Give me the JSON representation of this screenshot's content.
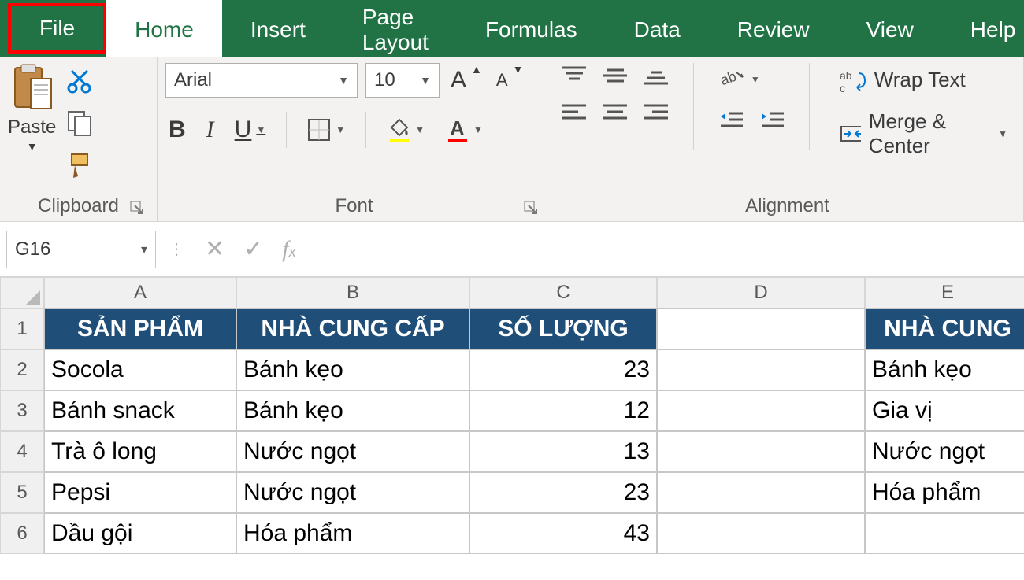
{
  "ribbon": {
    "tabs": [
      "File",
      "Home",
      "Insert",
      "Page Layout",
      "Formulas",
      "Data",
      "Review",
      "View",
      "Help"
    ],
    "activeTab": "Home",
    "clipboard": {
      "label": "Clipboard",
      "paste": "Paste"
    },
    "font": {
      "label": "Font",
      "name": "Arial",
      "size": "10",
      "bold": "B",
      "italic": "I",
      "underline": "U"
    },
    "alignment": {
      "label": "Alignment",
      "wrap": "Wrap Text",
      "merge": "Merge & Center"
    }
  },
  "formulaBar": {
    "cellRef": "G16",
    "formula": ""
  },
  "grid": {
    "columns": [
      "A",
      "B",
      "C",
      "D",
      "E"
    ],
    "rowNumbers": [
      "1",
      "2",
      "3",
      "4",
      "5",
      "6"
    ],
    "header": [
      "SẢN PHẨM",
      "NHÀ CUNG CẤP",
      "SỐ LƯỢNG",
      "",
      "NHÀ CUNG"
    ],
    "rows": [
      [
        "Socola",
        "Bánh kẹo",
        "23",
        "",
        "Bánh kẹo"
      ],
      [
        "Bánh snack",
        "Bánh kẹo",
        "12",
        "",
        "Gia vị"
      ],
      [
        "Trà ô long",
        "Nước ngọt",
        "13",
        "",
        "Nước ngọt"
      ],
      [
        "Pepsi",
        "Nước ngọt",
        "23",
        "",
        "Hóa phẩm"
      ],
      [
        "Dầu gội",
        "Hóa phẩm",
        "43",
        "",
        ""
      ]
    ]
  }
}
